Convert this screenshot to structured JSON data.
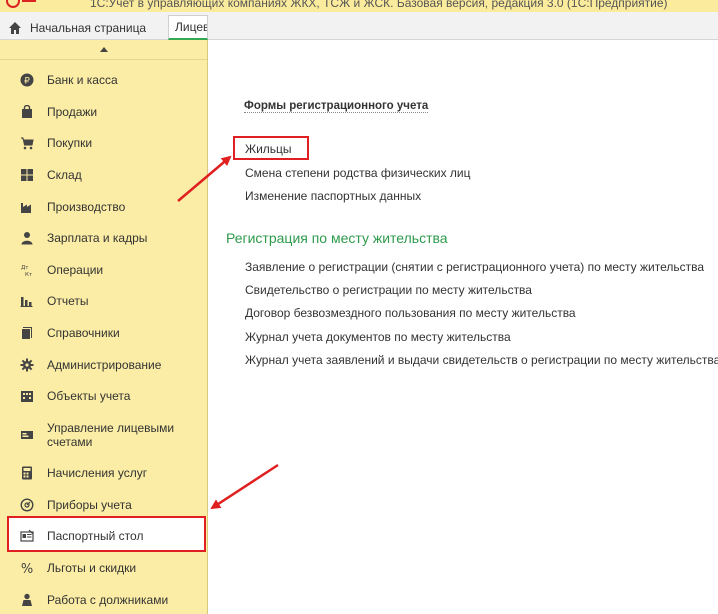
{
  "window": {
    "title": "1С:Учет в управляющих компаниях ЖКХ, ТСЖ и ЖСК. Базовая версия, редакция 3.0 (1С:Предприятие)"
  },
  "tabs": {
    "home_label": "Начальная страница",
    "accounts_label": "Лицевые счета"
  },
  "sidebar": {
    "items": [
      {
        "label": "Банк и касса",
        "icon": "ruble-icon"
      },
      {
        "label": "Продажи",
        "icon": "shopping-bag-icon"
      },
      {
        "label": "Покупки",
        "icon": "cart-icon"
      },
      {
        "label": "Склад",
        "icon": "warehouse-grid-icon"
      },
      {
        "label": "Производство",
        "icon": "factory-icon"
      },
      {
        "label": "Зарплата и кадры",
        "icon": "person-icon"
      },
      {
        "label": "Операции",
        "icon": "dt-kt-icon"
      },
      {
        "label": "Отчеты",
        "icon": "bar-chart-icon"
      },
      {
        "label": "Справочники",
        "icon": "books-icon"
      },
      {
        "label": "Администрирование",
        "icon": "gear-icon"
      },
      {
        "label": "Объекты учета",
        "icon": "building-icon"
      },
      {
        "label": "Управление лицевыми счетами",
        "icon": "card-icon"
      },
      {
        "label": "Начисления услуг",
        "icon": "calculator-icon"
      },
      {
        "label": "Приборы учета",
        "icon": "meter-icon"
      },
      {
        "label": "Паспортный стол",
        "icon": "passport-icon"
      },
      {
        "label": "Льготы и скидки",
        "icon": "percent-icon"
      },
      {
        "label": "Работа с должниками",
        "icon": "debtor-icon"
      }
    ],
    "active_item": "Паспортный стол"
  },
  "content": {
    "forms_title": "Формы регистрационного учета",
    "forms_links": [
      "Жильцы",
      "Смена степени родства физических лиц",
      "Изменение паспортных данных"
    ],
    "section_title": "Регистрация по месту жительства",
    "section_links": [
      "Заявление о регистрации (снятии с регистрационного учета) по месту жительства",
      "Свидетельство о регистрации по месту жительства",
      "Договор безвозмездного пользования по месту жительства",
      "Журнал учета документов по месту жительства",
      "Журнал учета заявлений и выдачи свидетельств о регистрации по месту жительства"
    ]
  },
  "colors": {
    "sidebar_bg": "#fbeda5",
    "highlight": "#e02020",
    "section_green": "#2e9a4c"
  }
}
